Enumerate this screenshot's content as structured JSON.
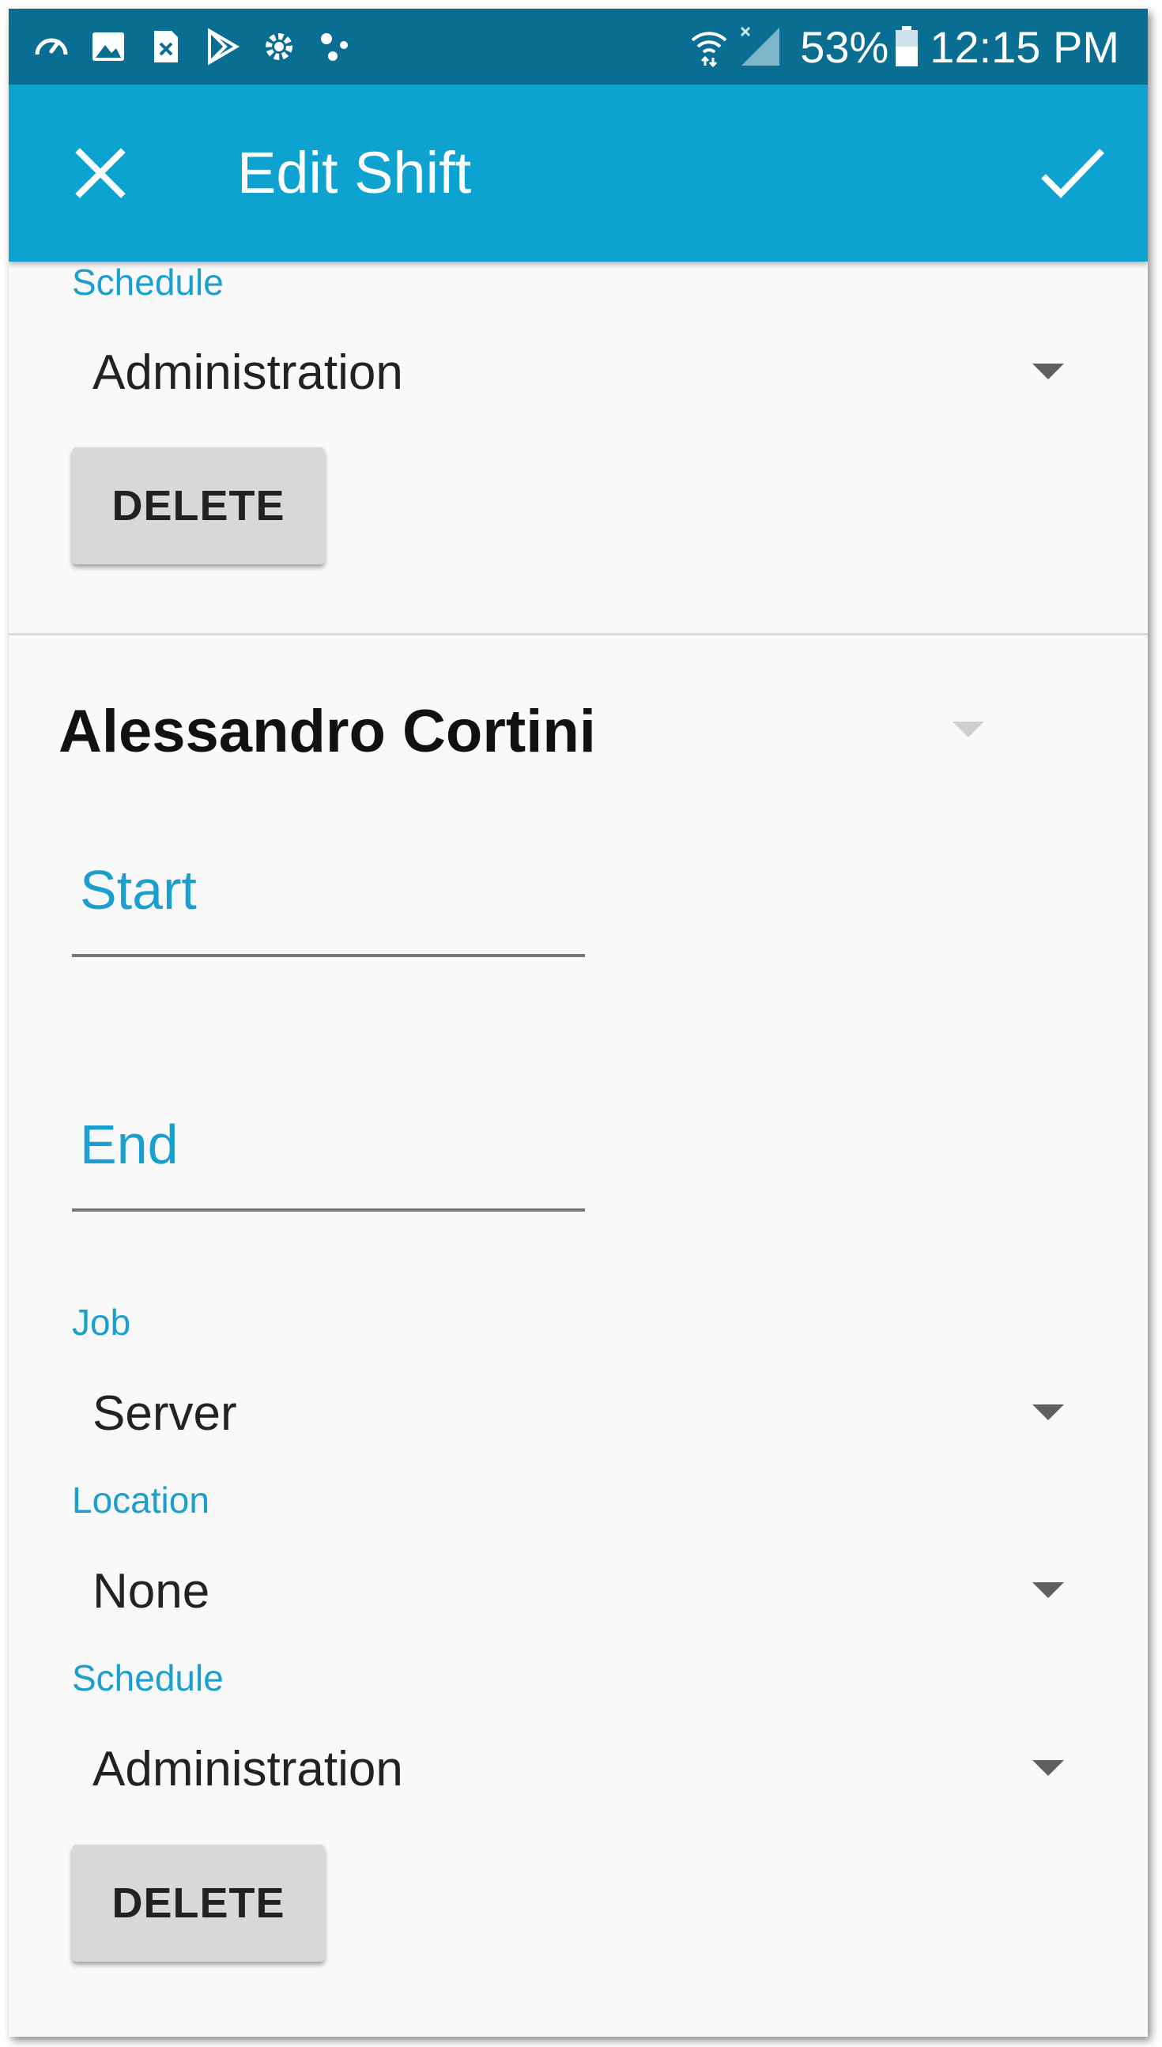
{
  "status_bar": {
    "icons": [
      "speedometer-icon",
      "image-icon",
      "sim-x-icon",
      "play-store-icon",
      "gear-cog-icon",
      "dots-icon"
    ],
    "battery": "53%",
    "time": "12:15 PM"
  },
  "app_bar": {
    "title": "Edit Shift",
    "close_icon": "close-icon",
    "confirm_icon": "check-icon",
    "background": "#0ea2d1"
  },
  "shift_previous": {
    "schedule_label": "Schedule",
    "schedule_value": "Administration",
    "delete_label": "DELETE"
  },
  "shift": {
    "employee_name": "Alessandro Cortini",
    "start_label": "Start",
    "end_label": "End",
    "job_label": "Job",
    "job_value": "Server",
    "location_label": "Location",
    "location_value": "None",
    "schedule_label": "Schedule",
    "schedule_value": "Administration",
    "delete_label": "DELETE"
  },
  "colors": {
    "accent": "#1a9fce",
    "status_bar": "#0a6e92"
  }
}
